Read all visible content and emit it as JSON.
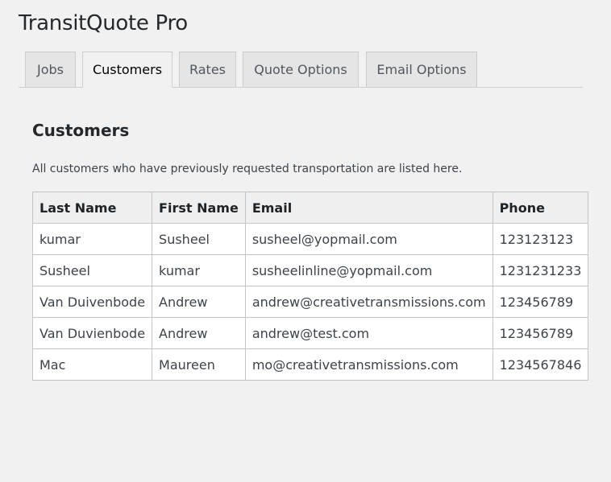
{
  "app": {
    "title": "TransitQuote Pro"
  },
  "tabs": [
    {
      "label": "Jobs",
      "active": false
    },
    {
      "label": "Customers",
      "active": true
    },
    {
      "label": "Rates",
      "active": false
    },
    {
      "label": "Quote Options",
      "active": false
    },
    {
      "label": "Email Options",
      "active": false
    }
  ],
  "section": {
    "title": "Customers",
    "description": "All customers who have previously requested transportation are listed here."
  },
  "table": {
    "headers": [
      "Last Name",
      "First Name",
      "Email",
      "Phone"
    ],
    "rows": [
      [
        "kumar",
        "Susheel",
        "susheel@yopmail.com",
        "123123123"
      ],
      [
        "Susheel",
        "kumar",
        "susheelinline@yopmail.com",
        "1231231233"
      ],
      [
        "Van Duivenbode",
        "Andrew",
        "andrew@creativetransmissions.com",
        "123456789"
      ],
      [
        "Van Duvienbode",
        "Andrew",
        "andrew@test.com",
        "123456789"
      ],
      [
        "Mac",
        "Maureen",
        "mo@creativetransmissions.com",
        "1234567846"
      ]
    ]
  }
}
